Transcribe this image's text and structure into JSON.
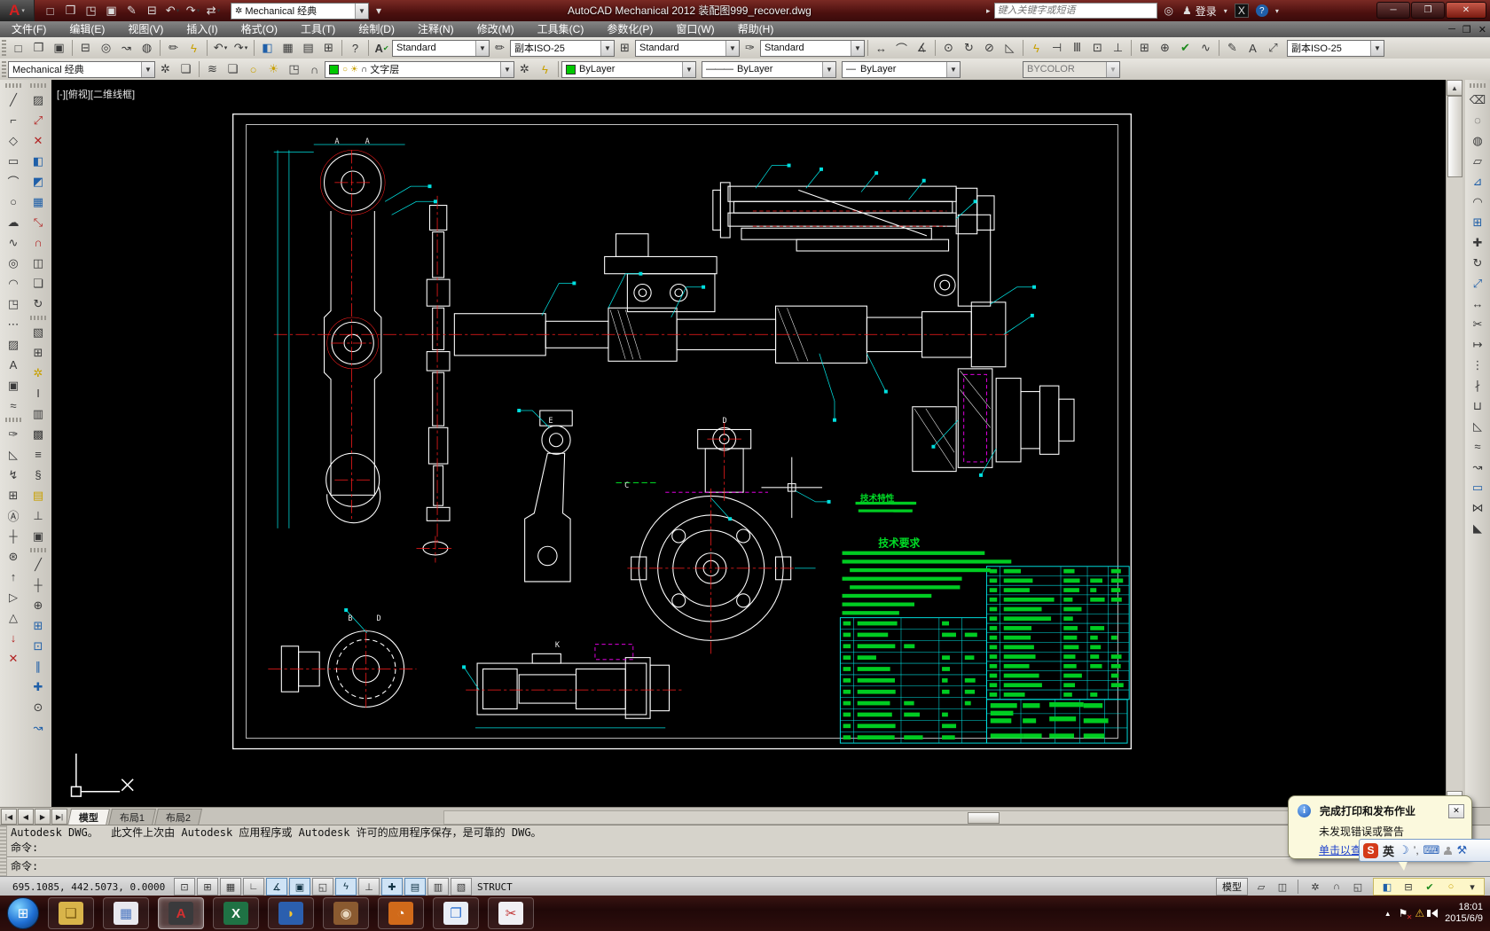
{
  "title_bar": {
    "logo": "A",
    "workspace": "Mechanical 经典",
    "title": "AutoCAD Mechanical 2012   装配图999_recover.dwg",
    "search_placeholder": "键入关键字或短语",
    "signin": "登录",
    "qat_icons": [
      {
        "n": "new",
        "g": "□"
      },
      {
        "n": "open",
        "g": "❒"
      },
      {
        "n": "open-vault",
        "g": "◳"
      },
      {
        "n": "save",
        "g": "▣"
      },
      {
        "n": "save-as",
        "g": "✎"
      },
      {
        "n": "plot",
        "g": "⊟"
      },
      {
        "n": "undo",
        "g": "↶",
        "dd": true
      },
      {
        "n": "redo",
        "g": "↷",
        "dd": true
      },
      {
        "n": "workspace-switch",
        "g": "⇄",
        "dd": true
      }
    ],
    "window_buttons": [
      {
        "n": "minimize",
        "g": "─"
      },
      {
        "n": "restore",
        "g": "❐"
      },
      {
        "n": "close",
        "g": "✕"
      }
    ]
  },
  "menu_bar": {
    "items": [
      "文件(F)",
      "编辑(E)",
      "视图(V)",
      "插入(I)",
      "格式(O)",
      "工具(T)",
      "绘制(D)",
      "注释(N)",
      "修改(M)",
      "工具集(C)",
      "参数化(P)",
      "窗口(W)",
      "帮助(H)"
    ],
    "doc_buttons": [
      {
        "n": "doc-minimize",
        "g": "─"
      },
      {
        "n": "doc-restore",
        "g": "❐"
      },
      {
        "n": "doc-close",
        "g": "✕"
      }
    ]
  },
  "toolbar1": {
    "left_icons": [
      {
        "n": "new",
        "g": "□"
      },
      {
        "n": "open",
        "g": "❒"
      },
      {
        "n": "save",
        "g": "▣"
      },
      {
        "sep": true
      },
      {
        "n": "plot",
        "g": "⊟"
      },
      {
        "n": "plot-preview",
        "g": "◎"
      },
      {
        "n": "publish",
        "g": "↝"
      },
      {
        "n": "export-dwf",
        "g": "◍"
      },
      {
        "sep": true
      },
      {
        "n": "match-properties",
        "g": "✏"
      },
      {
        "n": "match-lightning",
        "g": "ϟ",
        "c": "cy"
      },
      {
        "sep": true
      },
      {
        "n": "undo",
        "g": "↶",
        "dd": true
      },
      {
        "n": "redo",
        "g": "↷",
        "dd": true
      },
      {
        "sep": true
      },
      {
        "n": "viewport",
        "g": "◧",
        "c": "cb"
      },
      {
        "n": "sheet-set",
        "g": "▦"
      },
      {
        "n": "tool-palettes",
        "g": "▤"
      },
      {
        "n": "quick-calc",
        "g": "⊞"
      },
      {
        "sep": true
      },
      {
        "n": "help",
        "g": "?"
      }
    ],
    "text_style_icon": "A",
    "text_style": "Standard",
    "dim_style_icon": "✏",
    "dim_style": "副本ISO-25",
    "table_style_icon": "⊞",
    "table_style": "Standard",
    "mleader_style_icon": "✑",
    "mleader_style": "Standard",
    "dim_icons": [
      {
        "n": "dim-linear",
        "g": "↔"
      },
      {
        "n": "dim-aligned",
        "g": "⌒"
      },
      {
        "n": "dim-angular",
        "g": "∡"
      },
      {
        "sep": true
      },
      {
        "n": "dim-ordinate",
        "g": "⊙"
      },
      {
        "n": "dim-radius",
        "g": "↻"
      },
      {
        "n": "dim-diameter",
        "g": "⊘"
      },
      {
        "n": "dim-jogged",
        "g": "◺"
      },
      {
        "sep": true
      },
      {
        "n": "quick-dim",
        "g": "ϟ",
        "c": "cy"
      },
      {
        "n": "dim-baseline",
        "g": "⊣"
      },
      {
        "n": "dim-continue",
        "g": "Ⅲ"
      },
      {
        "n": "dim-space",
        "g": "⊡"
      },
      {
        "n": "dim-break",
        "g": "⊥"
      },
      {
        "sep": true
      },
      {
        "n": "tolerance",
        "g": "⊞"
      },
      {
        "n": "center-mark",
        "g": "⊕"
      },
      {
        "n": "dim-inspect",
        "g": "✔",
        "c": "cg"
      },
      {
        "n": "dim-jog-line",
        "g": "∿"
      },
      {
        "sep": true
      },
      {
        "n": "dim-edit",
        "g": "✎"
      },
      {
        "n": "dim-text-edit",
        "g": "A"
      },
      {
        "n": "dim-update",
        "g": "⤢"
      }
    ],
    "dim_style_combo": "副本ISO-25"
  },
  "toolbar2": {
    "workspace": "Mechanical 经典",
    "ws_icons": [
      {
        "n": "workspace-settings-gear",
        "g": "✲"
      },
      {
        "n": "workspace-frame",
        "g": "❏"
      }
    ],
    "layer_icons": [
      {
        "n": "layer-properties",
        "g": "≋"
      },
      {
        "n": "layer-new",
        "g": "❏"
      },
      {
        "n": "layer-bulb-on",
        "g": "○",
        "c": "cy"
      },
      {
        "n": "layer-freeze-sun",
        "g": "☀",
        "c": "cy"
      },
      {
        "n": "layer-match",
        "g": "◳"
      },
      {
        "n": "layer-unlock",
        "g": "∩"
      }
    ],
    "layer_swatch": "#00c800",
    "layer_value": "文字层",
    "layer_tail_icons": [
      {
        "n": "layer-previous",
        "g": "✲"
      },
      {
        "n": "layer-isolate",
        "g": "ϟ",
        "c": "cy"
      }
    ],
    "color_swatch": "#00c800",
    "color_value": "ByLayer",
    "linetype_value": "ByLayer",
    "lineweight_value": "ByLayer",
    "plotstyle_value": "BYCOLOR"
  },
  "left_toolbar_col1": [
    {
      "n": "line",
      "g": "╱"
    },
    {
      "n": "construction-line",
      "g": "⌐"
    },
    {
      "n": "polygon",
      "g": "◇"
    },
    {
      "n": "rectangle",
      "g": "▭"
    },
    {
      "n": "arc",
      "g": "⌒"
    },
    {
      "n": "circle",
      "g": "○"
    },
    {
      "n": "revision-cloud",
      "g": "☁"
    },
    {
      "n": "spline",
      "g": "∿"
    },
    {
      "n": "ellipse",
      "g": "◎"
    },
    {
      "n": "ellipse-arc",
      "g": "◠"
    },
    {
      "n": "insert-block",
      "g": "◳"
    },
    {
      "n": "point",
      "g": "⋯"
    },
    {
      "n": "hatch",
      "g": "▨"
    },
    {
      "n": "text",
      "g": "A"
    },
    {
      "n": "boundary",
      "g": "▣"
    },
    {
      "n": "wavy-line",
      "g": "≈"
    },
    {
      "sep": true
    },
    {
      "n": "leader-annotate",
      "g": "✑"
    },
    {
      "n": "chamfer-dim",
      "g": "◺"
    },
    {
      "n": "leader-n1",
      "g": "↯"
    },
    {
      "n": "feature-frame",
      "g": "⊞"
    },
    {
      "n": "datum-id",
      "g": "Ⓐ"
    },
    {
      "n": "dim-symmetry",
      "g": "┼"
    },
    {
      "n": "symbol-wheel",
      "g": "⊛"
    },
    {
      "n": "leader-plus",
      "g": "↑"
    },
    {
      "n": "play-direction",
      "g": "▷"
    },
    {
      "n": "surface-texture",
      "g": "△"
    },
    {
      "n": "leader-weld-plus",
      "g": "↓",
      "c": "cr"
    },
    {
      "n": "leader-weld-x",
      "g": "✕",
      "c": "cr"
    }
  ],
  "left_toolbar_col2": [
    {
      "n": "hatch-face",
      "g": "▨"
    },
    {
      "n": "power-snap",
      "g": "⤢",
      "c": "cr"
    },
    {
      "n": "power-erase",
      "g": "✕",
      "c": "cr"
    },
    {
      "n": "zoom-window-blue",
      "g": "◧",
      "c": "cb"
    },
    {
      "n": "detail-blue",
      "g": "◩",
      "c": "cb"
    },
    {
      "n": "nodes-rect",
      "g": "▦",
      "c": "cb"
    },
    {
      "n": "stretch-power",
      "g": "⤡",
      "c": "cr"
    },
    {
      "n": "magnet-snap",
      "g": "∩",
      "c": "cr"
    },
    {
      "n": "copy-view",
      "g": "◫"
    },
    {
      "n": "edit-view",
      "g": "❏"
    },
    {
      "n": "spell-rotate",
      "g": "↻"
    },
    {
      "sep": true
    },
    {
      "n": "block-3d",
      "g": "▧"
    },
    {
      "n": "table-mech",
      "g": "⊞"
    },
    {
      "n": "power-edit-gear",
      "g": "✲",
      "c": "cy"
    },
    {
      "n": "steel-shape",
      "g": "I"
    },
    {
      "n": "columns-shape",
      "g": "▥"
    },
    {
      "n": "hatch-columns",
      "g": "▩"
    },
    {
      "n": "split-section",
      "g": "≡"
    },
    {
      "n": "spring",
      "g": "§"
    },
    {
      "n": "thermal-color",
      "g": "▤",
      "c": "cy"
    },
    {
      "n": "fastener-screw",
      "g": "⊥"
    },
    {
      "n": "parts-gen",
      "g": "▣"
    },
    {
      "sep": true
    },
    {
      "n": "construction-dash",
      "g": "╱"
    },
    {
      "n": "center-cross",
      "g": "┼"
    },
    {
      "n": "circle-center",
      "g": "⊕"
    },
    {
      "n": "grid-holes-blue",
      "g": "⊞",
      "c": "cb"
    },
    {
      "n": "square-hole-blue",
      "g": "⊡",
      "c": "cb"
    },
    {
      "n": "parallel-lines",
      "g": "∥",
      "c": "cb"
    },
    {
      "n": "sym-marks-blue",
      "g": "✚",
      "c": "cb"
    },
    {
      "n": "target-point",
      "g": "⊙"
    },
    {
      "n": "construction-tool",
      "g": "↝",
      "c": "cb"
    }
  ],
  "right_toolbar": [
    {
      "n": "erase",
      "g": "⌫"
    },
    {
      "n": "copy",
      "g": "◌"
    },
    {
      "n": "copy-multiple",
      "g": "◍"
    },
    {
      "n": "offset",
      "g": "▱"
    },
    {
      "n": "mirror",
      "g": "⊿",
      "c": "cb"
    },
    {
      "n": "fillet",
      "g": "◠"
    },
    {
      "n": "array",
      "g": "⊞",
      "c": "cb"
    },
    {
      "n": "move",
      "g": "✚"
    },
    {
      "n": "rotate",
      "g": "↻"
    },
    {
      "n": "scale",
      "g": "⤢",
      "c": "cb"
    },
    {
      "n": "stretch",
      "g": "↔"
    },
    {
      "n": "trim",
      "g": "✂"
    },
    {
      "n": "extend",
      "g": "↦"
    },
    {
      "n": "break-at-point",
      "g": "⋮"
    },
    {
      "n": "break",
      "g": "∤"
    },
    {
      "n": "join",
      "g": "⊔"
    },
    {
      "n": "chamfer",
      "g": "◺"
    },
    {
      "n": "pedit",
      "g": "≈"
    },
    {
      "n": "spline-edit",
      "g": "↝"
    },
    {
      "n": "rect-edit",
      "g": "▭",
      "c": "cb"
    },
    {
      "n": "multiple-break",
      "g": "⋈"
    },
    {
      "n": "cover",
      "g": "◣"
    }
  ],
  "viewport": {
    "label": "[-][俯视][二维线框]"
  },
  "drawing": {
    "tech_props_title": "技术特性",
    "tech_req_title": "技术要求",
    "section_labels": [
      "A",
      "A",
      "E",
      "C",
      "D",
      "B",
      "D",
      "K"
    ],
    "colors": {
      "line": "#ffffff",
      "center": "#ff1e1e",
      "dims": "#00e0e0",
      "notes": "#00cc22",
      "detail": "#ff00ff"
    }
  },
  "tabs": {
    "nav": [
      {
        "n": "tab-first",
        "g": "|◀"
      },
      {
        "n": "tab-prev",
        "g": "◀"
      },
      {
        "n": "tab-next",
        "g": "▶"
      },
      {
        "n": "tab-last",
        "g": "▶|"
      }
    ],
    "items": [
      {
        "label": "模型",
        "active": true
      },
      {
        "label": "布局1",
        "active": false
      },
      {
        "label": "布局2",
        "active": false
      }
    ]
  },
  "command": {
    "line1": "Autodesk DWG。  此文件上次由 Autodesk 应用程序或 Autodesk 许可的应用程序保存，是可靠的 DWG。",
    "line2": "命令:",
    "prompt": "命令:"
  },
  "status": {
    "coords": "695.1085, 442.5073, 0.0000",
    "toggles": [
      {
        "n": "infer-constraints",
        "g": "⊡"
      },
      {
        "n": "snap-mode",
        "g": "⊞"
      },
      {
        "n": "grid-display",
        "g": "▦"
      },
      {
        "n": "ortho-mode",
        "g": "∟"
      },
      {
        "n": "polar-tracking",
        "g": "∡",
        "a": true
      },
      {
        "n": "object-snap",
        "g": "▣",
        "a": true
      },
      {
        "n": "object-snap-3d",
        "g": "◱"
      },
      {
        "n": "object-snap-tracking",
        "g": "ϟ",
        "a": true
      },
      {
        "n": "dynamic-ucs",
        "g": "⊥"
      },
      {
        "n": "dynamic-input",
        "g": "✚",
        "a": true
      },
      {
        "n": "show-lineweight",
        "g": "▤",
        "a": true
      },
      {
        "n": "quick-properties",
        "g": "▥"
      },
      {
        "n": "selection-cycling",
        "g": "▧"
      }
    ],
    "struct_label": "STRUCT",
    "model_label": "模型",
    "right_icons": [
      {
        "n": "quick-view-layouts",
        "g": "▱"
      },
      {
        "n": "quick-view-drawings",
        "g": "◫"
      }
    ],
    "right_icons2": [
      {
        "n": "annotation-scale-gear",
        "g": "✲"
      },
      {
        "n": "toolbar-lock",
        "g": "∩"
      },
      {
        "n": "clean-screen",
        "g": "◱"
      }
    ],
    "tray_icons": [
      {
        "n": "switch-window",
        "g": "◧",
        "c": "cb"
      },
      {
        "n": "plot-notify",
        "g": "⊟"
      },
      {
        "n": "trusted-check",
        "g": "✔",
        "c": "cg"
      },
      {
        "n": "performance-lamp",
        "g": "○",
        "c": "cy"
      },
      {
        "n": "tray-settings-arrow",
        "g": "▾"
      }
    ]
  },
  "balloon": {
    "title": "完成打印和发布作业",
    "line": "未发现错误或警告",
    "link": "单击以查看:"
  },
  "langbar": {
    "en_label": "英"
  },
  "taskbar": {
    "apps": [
      {
        "n": "explorer",
        "g": "❏",
        "bg": "#d8b44a",
        "fg": "#7a5a10"
      },
      {
        "n": "image-viewer",
        "g": "▦",
        "bg": "#e8e8ee",
        "fg": "#4a76c0"
      },
      {
        "n": "autocad",
        "g": "A",
        "bg": "#3a3a3c",
        "fg": "#d43030",
        "active": true
      },
      {
        "n": "excel",
        "g": "X",
        "bg": "#1f7244",
        "fg": "#ffffff"
      },
      {
        "n": "app-yellow-blue",
        "g": "◗",
        "bg": "#2b5fae",
        "fg": "#f4c430"
      },
      {
        "n": "paint-palette",
        "g": "◉",
        "bg": "#8a5a30",
        "fg": "#e8d8c0"
      },
      {
        "n": "app-orange",
        "g": "◔",
        "bg": "#d06a1a",
        "fg": "#ffffff"
      },
      {
        "n": "app-blue-frame",
        "g": "❐",
        "bg": "#e8eef6",
        "fg": "#2a6fd0"
      },
      {
        "n": "snipping-tool",
        "g": "✂",
        "bg": "#f0f0f4",
        "fg": "#c03030"
      }
    ],
    "clock_time": "18:01",
    "clock_date": "2015/6/9"
  }
}
